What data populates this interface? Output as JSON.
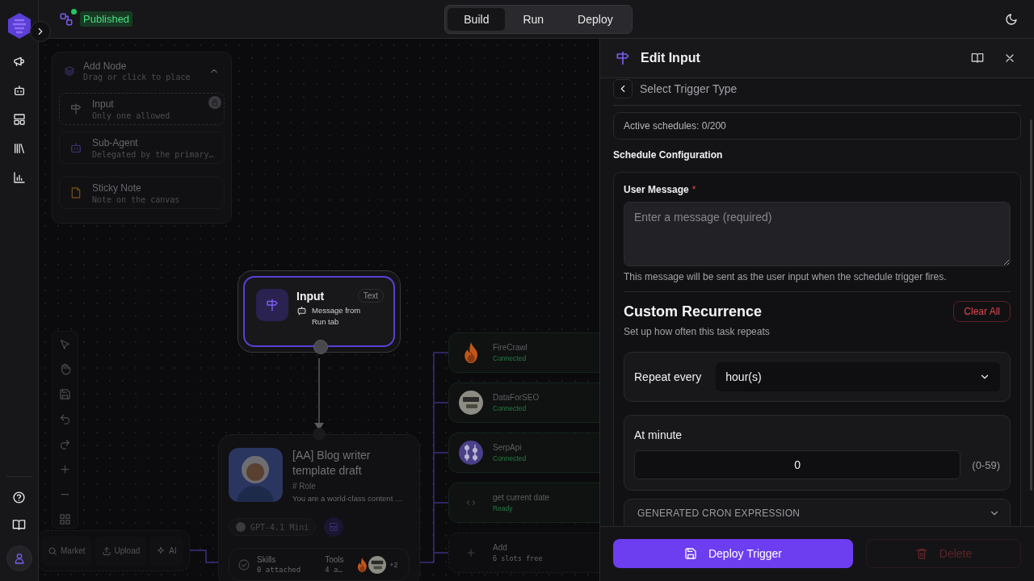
{
  "header": {
    "status_badge": "Published",
    "mode_tabs": [
      {
        "label": "Build",
        "selected": true
      },
      {
        "label": "Run",
        "selected": false
      },
      {
        "label": "Deploy",
        "selected": false
      }
    ]
  },
  "add_node_panel": {
    "title": "Add Node",
    "subtitle": "Drag or click to place",
    "expanded": true,
    "items": [
      {
        "kind": "input",
        "title": "Input",
        "subtitle": "Only one allowed",
        "locked": true
      },
      {
        "kind": "sub_agent",
        "title": "Sub-Agent",
        "subtitle": "Delegated by the primary…",
        "locked": false
      },
      {
        "kind": "sticky_note",
        "title": "Sticky Note",
        "subtitle": "Note on the canvas",
        "locked": false
      }
    ]
  },
  "canvas_actions": [
    {
      "kind": "market",
      "label": "Market"
    },
    {
      "kind": "upload",
      "label": "Upload"
    },
    {
      "kind": "ai",
      "label": "AI"
    }
  ],
  "input_node": {
    "title": "Input",
    "type_badge": "Text",
    "description": "Message from Run tab"
  },
  "agent_node": {
    "title": "[AA] Blog writer template draft",
    "role_heading": "# Role",
    "prompt_preview": "You are a world-class content …",
    "model": "GPT-4.1 Mini",
    "skills_label": "Skills",
    "skills_count": "0 attached",
    "tools_label": "Tools",
    "tools_count": "4 a…",
    "tools_more": "+2"
  },
  "tool_nodes": [
    {
      "kind": "flame",
      "name": "FireCrawl",
      "status": "Connected"
    },
    {
      "kind": "disc",
      "name": "DataForSEO",
      "status": "Connected"
    },
    {
      "kind": "dots",
      "name": "SerpApi",
      "status": "Connected"
    },
    {
      "kind": "code",
      "name": "get current date",
      "status": "Ready"
    },
    {
      "kind": "add",
      "name": "Add",
      "status": "6 slots free"
    }
  ],
  "edit_panel": {
    "title": "Edit Input",
    "back_label": "Select Trigger Type",
    "active_schedules": "Active schedules: 0/200",
    "section_title": "Schedule Configuration",
    "user_message": {
      "label": "User Message",
      "required_mark": "*",
      "placeholder": "Enter a message (required)",
      "help": "This message will be sent as the user input when the schedule trigger fires."
    },
    "recurrence": {
      "title": "Custom Recurrence",
      "clear_button": "Clear All",
      "subtitle": "Set up how often this task repeats",
      "repeat_label": "Repeat every",
      "repeat_value": "hour(s)",
      "minute_label": "At minute",
      "minute_value": "0",
      "minute_range": "(0-59)"
    },
    "cron": {
      "title": "GENERATED CRON EXPRESSION",
      "expanded": false
    },
    "deploy_button": "Deploy Trigger",
    "delete_button": {
      "label": "Delete",
      "disabled": true
    }
  }
}
